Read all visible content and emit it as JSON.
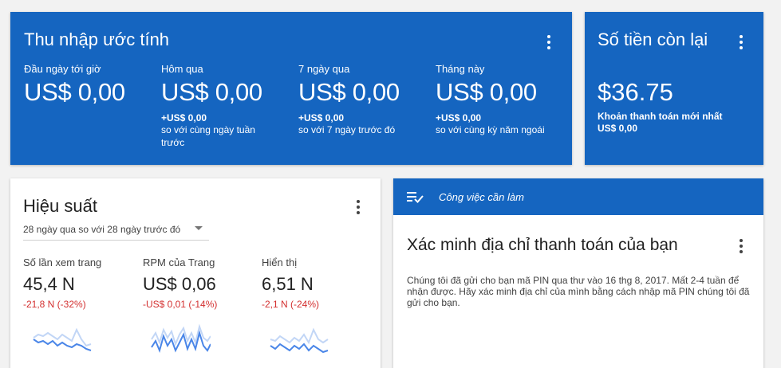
{
  "estimated_earnings": {
    "title": "Thu nhập ước tính",
    "metrics": [
      {
        "label": "Đầu ngày tới giờ",
        "value": "US$ 0,00",
        "delta": "",
        "compare": ""
      },
      {
        "label": "Hôm qua",
        "value": "US$ 0,00",
        "delta": "+US$ 0,00",
        "compare": "so với cùng ngày tuần trước"
      },
      {
        "label": "7 ngày qua",
        "value": "US$ 0,00",
        "delta": "+US$ 0,00",
        "compare": "so với 7 ngày trước đó"
      },
      {
        "label": "Tháng này",
        "value": "US$ 0,00",
        "delta": "+US$ 0,00",
        "compare": "so với cùng kỳ năm ngoái"
      }
    ]
  },
  "balance": {
    "title": "Số tiền còn lại",
    "amount": "$36.75",
    "last_payment_label": "Khoản thanh toán mới nhất",
    "last_payment_value": "US$ 0,00"
  },
  "performance": {
    "title": "Hiệu suất",
    "period": "28 ngày qua so với 28 ngày trước đó",
    "metrics": [
      {
        "label": "Số lần xem trang",
        "value": "45,4 N",
        "delta": "-21,8 N (-32%)"
      },
      {
        "label": "RPM của Trang",
        "value": "US$ 0,06",
        "delta": "-US$ 0,01 (-14%)"
      },
      {
        "label": "Hiển thị",
        "value": "6,51 N",
        "delta": "-2,1 N (-24%)"
      }
    ],
    "colors": {
      "current": "#4a86e8",
      "previous": "#c2d6f6",
      "negative": "#d32f2f"
    }
  },
  "todo": {
    "header": "Công việc cần làm",
    "task_title": "Xác minh địa chỉ thanh toán của bạn",
    "task_body": "Chúng tôi đã gửi cho bạn mã PIN qua thư vào 16 thg 8, 2017. Mất 2-4 tuần để nhận được. Hãy xác minh địa chỉ của mình bằng cách nhập mã PIN chúng tôi đã gửi cho bạn."
  },
  "colors": {
    "brand_blue": "#1565c0",
    "background": "#f2f2f2"
  }
}
